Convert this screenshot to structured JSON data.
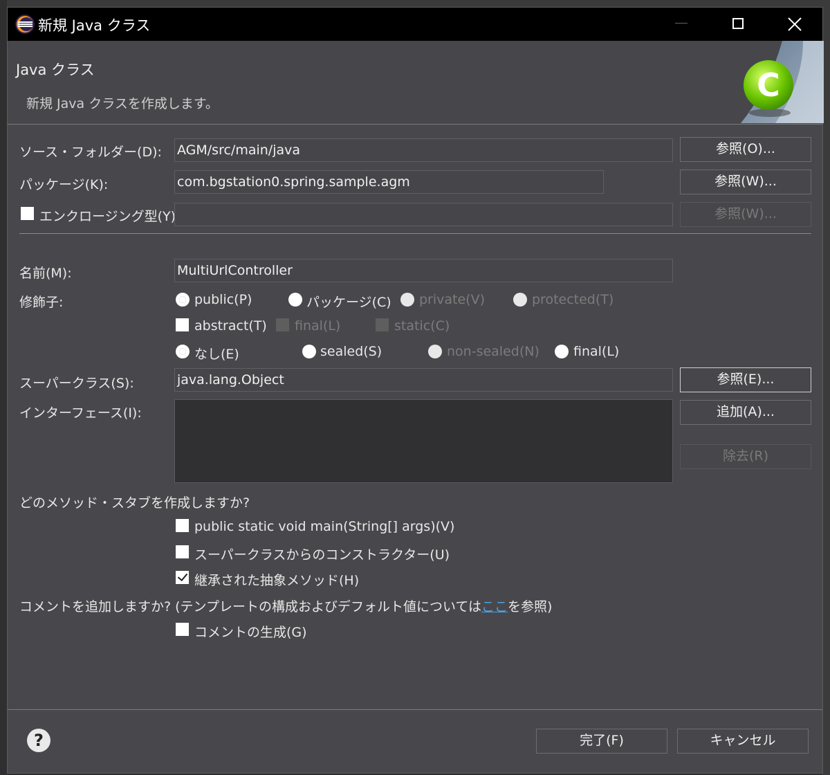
{
  "window": {
    "title": "新規 Java クラス"
  },
  "banner": {
    "title": "Java クラス",
    "description": "新規 Java クラスを作成します。"
  },
  "source_folder": {
    "label": "ソース・フォルダー(D):",
    "value": "AGM/src/main/java",
    "browse": "参照(O)..."
  },
  "package": {
    "label": "パッケージ(K):",
    "value": "com.bgstation0.spring.sample.agm",
    "browse": "参照(W)..."
  },
  "enclosing": {
    "label": "エンクロージング型(Y):",
    "value": "",
    "browse": "参照(W)...",
    "checked": false
  },
  "name": {
    "label": "名前(M):",
    "value": "MultiUrlController"
  },
  "modifiers": {
    "label": "修飾子:",
    "access": [
      {
        "label": "public(P)",
        "selected": true,
        "enabled": true
      },
      {
        "label": "パッケージ(C)",
        "selected": false,
        "enabled": true
      },
      {
        "label": "private(V)",
        "selected": false,
        "enabled": false
      },
      {
        "label": "protected(T)",
        "selected": false,
        "enabled": false
      }
    ],
    "flags": [
      {
        "label": "abstract(T)",
        "checked": false,
        "enabled": true
      },
      {
        "label": "final(L)",
        "checked": false,
        "enabled": false
      },
      {
        "label": "static(C)",
        "checked": false,
        "enabled": false
      }
    ],
    "sealing": [
      {
        "label": "なし(E)",
        "selected": true,
        "enabled": true
      },
      {
        "label": "sealed(S)",
        "selected": false,
        "enabled": true
      },
      {
        "label": "non-sealed(N)",
        "selected": false,
        "enabled": false
      },
      {
        "label": "final(L)",
        "selected": false,
        "enabled": true
      }
    ]
  },
  "superclass": {
    "label": "スーパークラス(S):",
    "value": "java.lang.Object",
    "browse": "参照(E)..."
  },
  "interfaces": {
    "label": "インターフェース(I):",
    "add": "追加(A)...",
    "remove": "除去(R)"
  },
  "stubs": {
    "question": "どのメソッド・スタブを作成しますか?",
    "options": [
      {
        "label": "public static void main(String[] args)(V)",
        "checked": false
      },
      {
        "label": "スーパークラスからのコンストラクター(U)",
        "checked": false
      },
      {
        "label": "継承された抽象メソッド(H)",
        "checked": true
      }
    ]
  },
  "comments": {
    "question_prefix": "コメントを追加しますか? (テンプレートの構成およびデフォルト値については",
    "link": "ここ",
    "question_suffix": "を参照)",
    "generate": {
      "label": "コメントの生成(G)",
      "checked": false
    }
  },
  "footer": {
    "help": "?",
    "finish": "完了(F)",
    "cancel": "キャンセル"
  }
}
